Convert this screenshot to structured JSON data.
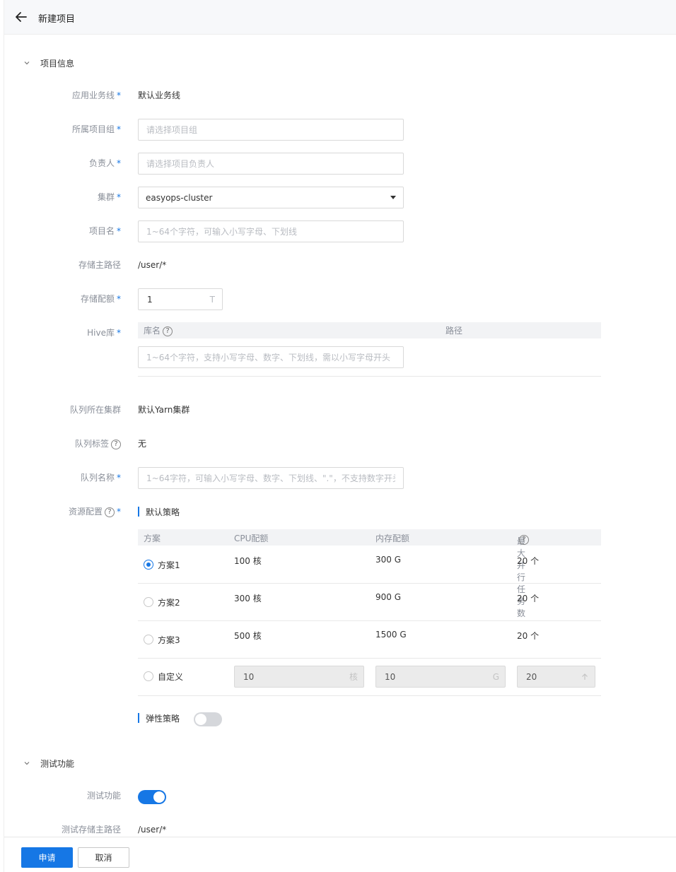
{
  "header": {
    "title": "新建项目"
  },
  "sections": {
    "project_info": "项目信息",
    "test_feature": "测试功能"
  },
  "fields": {
    "business_line": {
      "label": "应用业务线",
      "value": "默认业务线"
    },
    "project_group": {
      "label": "所属项目组",
      "placeholder": "请选择项目组"
    },
    "owner": {
      "label": "负责人",
      "placeholder": "请选择项目负责人"
    },
    "cluster": {
      "label": "集群",
      "value": "easyops-cluster"
    },
    "project_name": {
      "label": "项目名",
      "placeholder": "1~64个字符，可输入小写字母、下划线"
    },
    "storage_path": {
      "label": "存储主路径",
      "value": "/user/*"
    },
    "storage_quota": {
      "label": "存储配额",
      "value": "1",
      "unit": "T"
    },
    "hive": {
      "label": "Hive库",
      "col_name": "库名",
      "col_path": "路径",
      "placeholder": "1~64个字符，支持小写字母、数字、下划线，需以小写字母开头"
    },
    "queue_cluster": {
      "label": "队列所在集群",
      "value": "默认Yarn集群"
    },
    "queue_tag": {
      "label": "队列标签",
      "value": "无"
    },
    "queue_name": {
      "label": "队列名称",
      "placeholder": "1~64字符，可输入小写字母、数字、下划线、\".\"，不支持数字开头"
    },
    "resource": {
      "label": "资源配置"
    }
  },
  "resource_policy": {
    "default_title": "默认策略",
    "elastic_title": "弹性策略",
    "columns": [
      "方案",
      "CPU配额",
      "内存配额",
      "最大并行任务数"
    ],
    "plans": [
      {
        "name": "方案1",
        "cpu": "100 核",
        "mem": "300 G",
        "tasks": "20 个"
      },
      {
        "name": "方案2",
        "cpu": "300 核",
        "mem": "900 G",
        "tasks": "20 个"
      },
      {
        "name": "方案3",
        "cpu": "500 核",
        "mem": "1500 G",
        "tasks": "20 个"
      }
    ],
    "custom": {
      "name": "自定义",
      "cpu": "10",
      "cpu_unit": "核",
      "mem": "10",
      "mem_unit": "G",
      "tasks": "20"
    },
    "selected_plan": 0,
    "elastic_enabled": false
  },
  "test": {
    "feature_label": "测试功能",
    "feature_enabled": true,
    "storage_label": "测试存储主路径",
    "storage_value": "/user/*"
  },
  "footer": {
    "submit": "申请",
    "cancel": "取消"
  },
  "colors": {
    "accent": "#1677e5",
    "required": "#1677e5"
  }
}
